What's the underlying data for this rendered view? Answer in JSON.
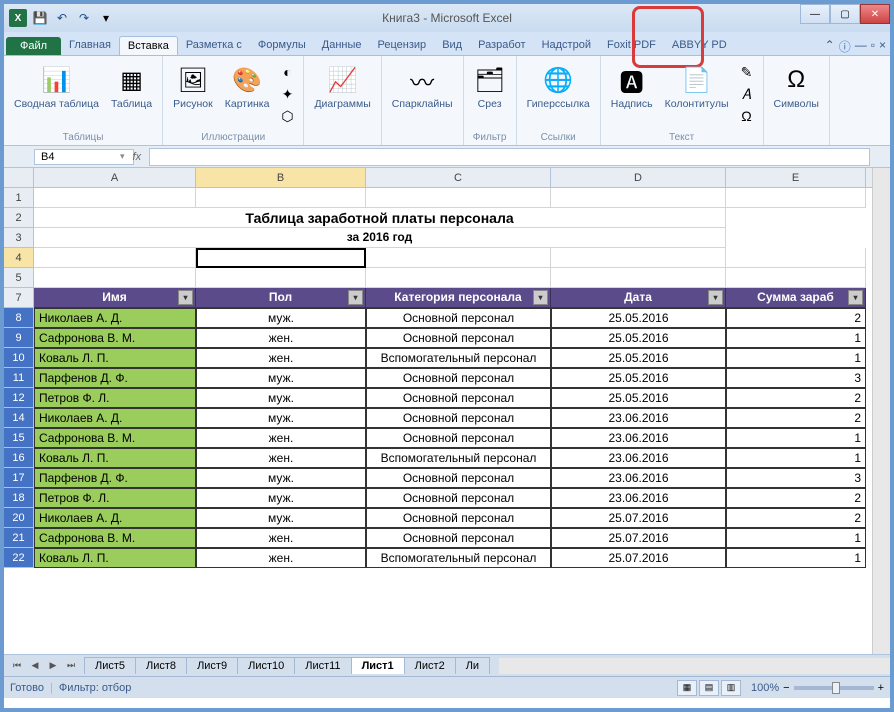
{
  "title": "Книга3 - Microsoft Excel",
  "tabs": {
    "file": "Файл",
    "list": [
      "Главная",
      "Вставка",
      "Разметка с",
      "Формулы",
      "Данные",
      "Рецензир",
      "Вид",
      "Разработ",
      "Надстрой",
      "Foxit PDF",
      "ABBYY PD"
    ],
    "active_index": 1
  },
  "ribbon": {
    "groups": [
      {
        "label": "Таблицы",
        "items": [
          {
            "label": "Сводная\nтаблица",
            "icon": "📊"
          },
          {
            "label": "Таблица",
            "icon": "▦"
          }
        ]
      },
      {
        "label": "Иллюстрации",
        "items": [
          {
            "label": "Рисунок",
            "icon": "🖼"
          },
          {
            "label": "Картинка",
            "icon": "🎨"
          }
        ],
        "small": [
          "◐",
          "✦",
          "⬡"
        ]
      },
      {
        "label": "",
        "items": [
          {
            "label": "Диаграммы",
            "icon": "📈"
          }
        ]
      },
      {
        "label": "",
        "items": [
          {
            "label": "Спарклайны",
            "icon": "〰"
          }
        ]
      },
      {
        "label": "Фильтр",
        "items": [
          {
            "label": "Срез",
            "icon": "🗂"
          }
        ]
      },
      {
        "label": "Ссылки",
        "items": [
          {
            "label": "Гиперссылка",
            "icon": "🌐"
          }
        ]
      },
      {
        "label": "Текст",
        "items": [
          {
            "label": "Надпись",
            "icon": "🅰"
          },
          {
            "label": "Колонтитулы",
            "icon": "📄"
          }
        ],
        "small": [
          "✎",
          "𝐴",
          "Ω"
        ]
      },
      {
        "label": "",
        "items": [
          {
            "label": "Символы",
            "icon": "Ω"
          }
        ]
      }
    ]
  },
  "name_box": "B4",
  "columns": [
    "A",
    "B",
    "C",
    "D",
    "E"
  ],
  "title_row": "Таблица заработной платы персонала",
  "subtitle_row": "за 2016 год",
  "headers": [
    "Имя",
    "Пол",
    "Категория персонала",
    "Дата",
    "Сумма зараб"
  ],
  "rows": [
    {
      "n": 8,
      "name": "Николаев А. Д.",
      "sex": "муж.",
      "cat": "Основной персонал",
      "date": "25.05.2016",
      "sum": "2"
    },
    {
      "n": 9,
      "name": "Сафронова В. М.",
      "sex": "жен.",
      "cat": "Основной персонал",
      "date": "25.05.2016",
      "sum": "1"
    },
    {
      "n": 10,
      "name": "Коваль Л. П.",
      "sex": "жен.",
      "cat": "Вспомогательный персонал",
      "date": "25.05.2016",
      "sum": "1"
    },
    {
      "n": 11,
      "name": "Парфенов Д. Ф.",
      "sex": "муж.",
      "cat": "Основной персонал",
      "date": "25.05.2016",
      "sum": "3"
    },
    {
      "n": 12,
      "name": "Петров Ф. Л.",
      "sex": "муж.",
      "cat": "Основной персонал",
      "date": "25.05.2016",
      "sum": "2"
    },
    {
      "n": 14,
      "name": "Николаев А. Д.",
      "sex": "муж.",
      "cat": "Основной персонал",
      "date": "23.06.2016",
      "sum": "2"
    },
    {
      "n": 15,
      "name": "Сафронова В. М.",
      "sex": "жен.",
      "cat": "Основной персонал",
      "date": "23.06.2016",
      "sum": "1"
    },
    {
      "n": 16,
      "name": "Коваль Л. П.",
      "sex": "жен.",
      "cat": "Вспомогательный персонал",
      "date": "23.06.2016",
      "sum": "1"
    },
    {
      "n": 17,
      "name": "Парфенов Д. Ф.",
      "sex": "муж.",
      "cat": "Основной персонал",
      "date": "23.06.2016",
      "sum": "3"
    },
    {
      "n": 18,
      "name": "Петров Ф. Л.",
      "sex": "муж.",
      "cat": "Основной персонал",
      "date": "23.06.2016",
      "sum": "2"
    },
    {
      "n": 20,
      "name": "Николаев А. Д.",
      "sex": "муж.",
      "cat": "Основной персонал",
      "date": "25.07.2016",
      "sum": "2"
    },
    {
      "n": 21,
      "name": "Сафронова В. М.",
      "sex": "жен.",
      "cat": "Основной персонал",
      "date": "25.07.2016",
      "sum": "1"
    },
    {
      "n": 22,
      "name": "Коваль Л. П.",
      "sex": "жен.",
      "cat": "Вспомогательный персонал",
      "date": "25.07.2016",
      "sum": "1"
    }
  ],
  "sheets": [
    "Лист5",
    "Лист8",
    "Лист9",
    "Лист10",
    "Лист11",
    "Лист1",
    "Лист2",
    "Ли"
  ],
  "active_sheet": 5,
  "status": {
    "ready": "Готово",
    "filter": "Фильтр: отбор"
  },
  "zoom": "100%"
}
